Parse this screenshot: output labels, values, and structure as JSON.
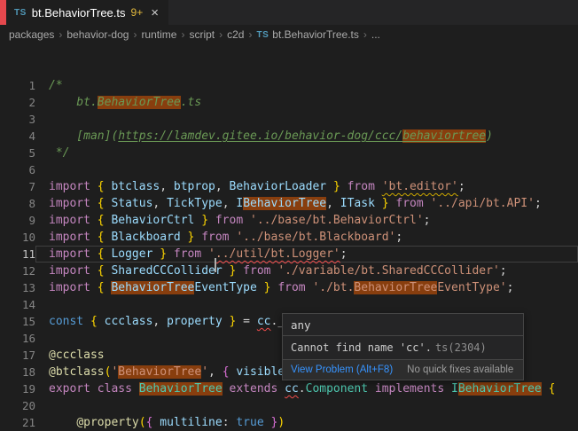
{
  "tab": {
    "icon_label": "TS",
    "title": "bt.BehaviorTree.ts",
    "badge": "9+",
    "close_glyph": "×"
  },
  "breadcrumbs": {
    "items": [
      "packages",
      "behavior-dog",
      "runtime",
      "script",
      "c2d"
    ],
    "separator": "›",
    "file_icon": "TS",
    "file": "bt.BehaviorTree.ts",
    "more": "..."
  },
  "editor": {
    "current_line": 11,
    "lines": [
      {
        "n": 1,
        "tokens": [
          {
            "t": "/*",
            "c": "cmt"
          }
        ]
      },
      {
        "n": 2,
        "tokens": [
          {
            "t": "    bt.",
            "c": "cmt"
          },
          {
            "t": "BehaviorTree",
            "c": "cmt",
            "hl": 1
          },
          {
            "t": ".ts",
            "c": "cmt"
          }
        ]
      },
      {
        "n": 3,
        "tokens": []
      },
      {
        "n": 4,
        "tokens": [
          {
            "t": "    [man](",
            "c": "cmt"
          },
          {
            "t": "https://lamdev.gitee.io/behavior-dog/ccc/",
            "c": "cmt",
            "link": 1
          },
          {
            "t": "behaviortree",
            "c": "cmt",
            "link": 1,
            "hl": 1
          },
          {
            "t": ")",
            "c": "cmt"
          }
        ]
      },
      {
        "n": 5,
        "tokens": [
          {
            "t": " */",
            "c": "cmt"
          }
        ]
      },
      {
        "n": 6,
        "tokens": []
      },
      {
        "n": 7,
        "tokens": [
          {
            "t": "import",
            "c": "kw"
          },
          {
            "t": " ",
            "c": "pun"
          },
          {
            "t": "{",
            "c": "brace"
          },
          {
            "t": " btclass",
            "c": "var"
          },
          {
            "t": ", ",
            "c": "pun"
          },
          {
            "t": "btprop",
            "c": "var"
          },
          {
            "t": ", ",
            "c": "pun"
          },
          {
            "t": "BehaviorLoader",
            "c": "var"
          },
          {
            "t": " ",
            "c": "pun"
          },
          {
            "t": "}",
            "c": "brace"
          },
          {
            "t": " ",
            "c": "pun"
          },
          {
            "t": "from",
            "c": "kw"
          },
          {
            "t": " ",
            "c": "pun"
          },
          {
            "t": "'bt.editor'",
            "c": "str",
            "warn": 1
          },
          {
            "t": ";",
            "c": "pun"
          }
        ]
      },
      {
        "n": 8,
        "tokens": [
          {
            "t": "import",
            "c": "kw"
          },
          {
            "t": " ",
            "c": "pun"
          },
          {
            "t": "{",
            "c": "brace"
          },
          {
            "t": " Status",
            "c": "var"
          },
          {
            "t": ", ",
            "c": "pun"
          },
          {
            "t": "TickType",
            "c": "var"
          },
          {
            "t": ", ",
            "c": "pun"
          },
          {
            "t": "I",
            "c": "var"
          },
          {
            "t": "BehaviorTree",
            "c": "var",
            "hl": 1
          },
          {
            "t": ", ",
            "c": "pun"
          },
          {
            "t": "ITask",
            "c": "var"
          },
          {
            "t": " ",
            "c": "pun"
          },
          {
            "t": "}",
            "c": "brace"
          },
          {
            "t": " ",
            "c": "pun"
          },
          {
            "t": "from",
            "c": "kw"
          },
          {
            "t": " ",
            "c": "pun"
          },
          {
            "t": "'../api/bt.API'",
            "c": "str"
          },
          {
            "t": ";",
            "c": "pun"
          }
        ]
      },
      {
        "n": 9,
        "tokens": [
          {
            "t": "import",
            "c": "kw"
          },
          {
            "t": " ",
            "c": "pun"
          },
          {
            "t": "{",
            "c": "brace"
          },
          {
            "t": " BehaviorCtrl",
            "c": "var"
          },
          {
            "t": " ",
            "c": "pun"
          },
          {
            "t": "}",
            "c": "brace"
          },
          {
            "t": " ",
            "c": "pun"
          },
          {
            "t": "from",
            "c": "kw"
          },
          {
            "t": " ",
            "c": "pun"
          },
          {
            "t": "'../base/bt.BehaviorCtrl'",
            "c": "str"
          },
          {
            "t": ";",
            "c": "pun"
          }
        ]
      },
      {
        "n": 10,
        "tokens": [
          {
            "t": "import",
            "c": "kw"
          },
          {
            "t": " ",
            "c": "pun"
          },
          {
            "t": "{",
            "c": "brace"
          },
          {
            "t": " Blackboard",
            "c": "var"
          },
          {
            "t": " ",
            "c": "pun"
          },
          {
            "t": "}",
            "c": "brace"
          },
          {
            "t": " ",
            "c": "pun"
          },
          {
            "t": "from",
            "c": "kw"
          },
          {
            "t": " ",
            "c": "pun"
          },
          {
            "t": "'../base/bt.Blackboard'",
            "c": "str"
          },
          {
            "t": ";",
            "c": "pun"
          }
        ]
      },
      {
        "n": 11,
        "tokens": [
          {
            "t": "import",
            "c": "kw"
          },
          {
            "t": " ",
            "c": "pun"
          },
          {
            "t": "{",
            "c": "brace"
          },
          {
            "t": " Logger",
            "c": "var"
          },
          {
            "t": " ",
            "c": "pun"
          },
          {
            "t": "}",
            "c": "brace"
          },
          {
            "t": " ",
            "c": "pun"
          },
          {
            "t": "from",
            "c": "kw"
          },
          {
            "t": " ",
            "c": "pun"
          },
          {
            "t": "'",
            "c": "str"
          },
          {
            "cursor": 1
          },
          {
            "t": "../util/bt.Logger'",
            "c": "str",
            "err": 1
          },
          {
            "t": ";",
            "c": "pun"
          }
        ]
      },
      {
        "n": 12,
        "tokens": [
          {
            "t": "import",
            "c": "kw"
          },
          {
            "t": " ",
            "c": "pun"
          },
          {
            "t": "{",
            "c": "brace"
          },
          {
            "t": " SharedCCCollider",
            "c": "var"
          },
          {
            "t": " ",
            "c": "pun"
          },
          {
            "t": "}",
            "c": "brace"
          },
          {
            "t": " ",
            "c": "pun"
          },
          {
            "t": "from",
            "c": "kw"
          },
          {
            "t": " ",
            "c": "pun"
          },
          {
            "t": "'./variable/bt.SharedCCCollider'",
            "c": "str"
          },
          {
            "t": ";",
            "c": "pun"
          }
        ]
      },
      {
        "n": 13,
        "tokens": [
          {
            "t": "import",
            "c": "kw"
          },
          {
            "t": " ",
            "c": "pun"
          },
          {
            "t": "{",
            "c": "brace"
          },
          {
            "t": " ",
            "c": "pun"
          },
          {
            "t": "BehaviorTree",
            "c": "var",
            "hl": 1
          },
          {
            "t": "EventType",
            "c": "var"
          },
          {
            "t": " ",
            "c": "pun"
          },
          {
            "t": "}",
            "c": "brace"
          },
          {
            "t": " ",
            "c": "pun"
          },
          {
            "t": "from",
            "c": "kw"
          },
          {
            "t": " ",
            "c": "pun"
          },
          {
            "t": "'./bt.",
            "c": "str"
          },
          {
            "t": "BehaviorTree",
            "c": "str",
            "hl": 1
          },
          {
            "t": "EventType'",
            "c": "str"
          },
          {
            "t": ";",
            "c": "pun"
          }
        ]
      },
      {
        "n": 14,
        "tokens": []
      },
      {
        "n": 15,
        "tokens": [
          {
            "t": "const",
            "c": "kw2"
          },
          {
            "t": " ",
            "c": "pun"
          },
          {
            "t": "{",
            "c": "brace"
          },
          {
            "t": " ccclass",
            "c": "var"
          },
          {
            "t": ", ",
            "c": "pun"
          },
          {
            "t": "property",
            "c": "var"
          },
          {
            "t": " ",
            "c": "pun"
          },
          {
            "t": "}",
            "c": "brace"
          },
          {
            "t": " = ",
            "c": "pun"
          },
          {
            "t": "cc",
            "c": "var",
            "err": 1
          },
          {
            "t": "._decorator;",
            "c": "pun"
          }
        ]
      },
      {
        "n": 16,
        "tokens": []
      },
      {
        "n": 17,
        "tokens": [
          {
            "t": "@ccclass",
            "c": "fn"
          }
        ]
      },
      {
        "n": 18,
        "tokens": [
          {
            "t": "@btclass",
            "c": "fn"
          },
          {
            "t": "(",
            "c": "brace"
          },
          {
            "t": "'",
            "c": "str"
          },
          {
            "t": "BehaviorTree",
            "c": "str",
            "hl": 1
          },
          {
            "t": "'",
            "c": "str"
          },
          {
            "t": ", ",
            "c": "pun"
          },
          {
            "t": "{",
            "c": "brace2"
          },
          {
            "t": " visible",
            "c": "var"
          },
          {
            "t": ": ",
            "c": "pun"
          },
          {
            "t": "true",
            "c": "kw2"
          },
          {
            "t": " ",
            "c": "pun"
          },
          {
            "t": "}",
            "c": "brace2"
          },
          {
            "t": ")",
            "c": "brace"
          }
        ]
      },
      {
        "n": 19,
        "tokens": [
          {
            "t": "export",
            "c": "kw"
          },
          {
            "t": " ",
            "c": "pun"
          },
          {
            "t": "class",
            "c": "kw"
          },
          {
            "t": " ",
            "c": "pun"
          },
          {
            "t": "BehaviorTree",
            "c": "type",
            "hl": 1
          },
          {
            "t": " ",
            "c": "pun"
          },
          {
            "t": "extends",
            "c": "kw"
          },
          {
            "t": " ",
            "c": "pun"
          },
          {
            "t": "cc",
            "c": "var",
            "err": 1
          },
          {
            "t": ".",
            "c": "pun"
          },
          {
            "t": "Component",
            "c": "type"
          },
          {
            "t": " ",
            "c": "pun"
          },
          {
            "t": "implements",
            "c": "kw"
          },
          {
            "t": " ",
            "c": "pun"
          },
          {
            "t": "I",
            "c": "type"
          },
          {
            "t": "BehaviorTree",
            "c": "type",
            "hl": 1
          },
          {
            "t": " ",
            "c": "pun"
          },
          {
            "t": "{",
            "c": "brace"
          }
        ]
      },
      {
        "n": 20,
        "tokens": []
      },
      {
        "n": 21,
        "tokens": [
          {
            "t": "    ",
            "c": "pun"
          },
          {
            "t": "@property",
            "c": "fn"
          },
          {
            "t": "(",
            "c": "brace"
          },
          {
            "t": "{",
            "c": "brace2"
          },
          {
            "t": " multiline",
            "c": "var"
          },
          {
            "t": ": ",
            "c": "pun"
          },
          {
            "t": "true",
            "c": "kw2"
          },
          {
            "t": " ",
            "c": "pun"
          },
          {
            "t": "}",
            "c": "brace2"
          },
          {
            "t": ")",
            "c": "brace"
          }
        ]
      }
    ]
  },
  "popup": {
    "type_text": "any",
    "message": "Cannot find name 'cc'.",
    "code": "ts(2304)",
    "view_problem": "View Problem (Alt+F8)",
    "no_fix": "No quick fixes available"
  },
  "colors": {
    "background": "#1e1e1e",
    "tabbar_background": "#252526",
    "left_accent_red": "#e5484d",
    "match_highlight_orange": "#ea5c00",
    "error_red": "#f14c4c",
    "warning_gold": "#cca700",
    "link_blue": "#3794ff",
    "ts_icon_blue": "#519aba",
    "comment_green": "#6a9955",
    "keyword_pink": "#c586c0",
    "string_orange": "#ce9178",
    "variable_blue": "#9cdcfe",
    "type_teal": "#4ec9b0",
    "badge_gold": "#e2b93d"
  }
}
